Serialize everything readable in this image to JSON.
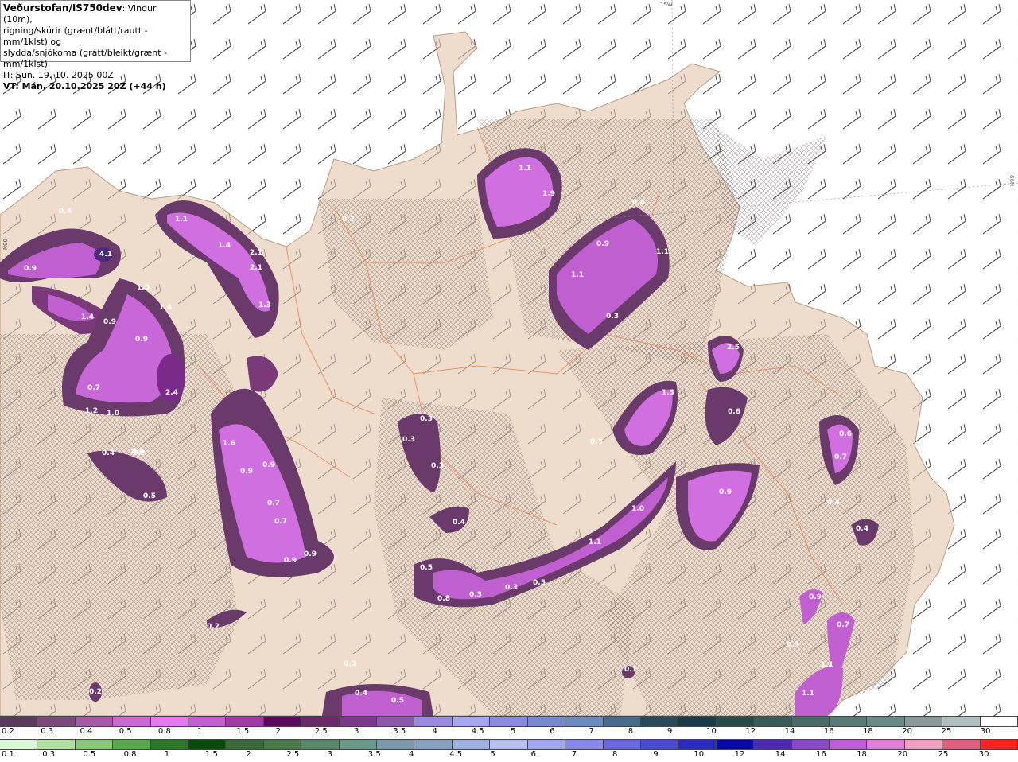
{
  "legend": {
    "title": "Veðurstofan/IS750dev",
    "line1": ": Vindur (10m),",
    "line2": "rigning/skúrir (grænt/blátt/rautt - mm/1klst) og",
    "line3": "slydda/snjókoma (grátt/bleikt/grænt - mm/1klst)",
    "it": "IT: Sun. 19. 10. 2025 00Z",
    "vt": "VT: Mán. 20.10.2025 20Z (+44 h)"
  },
  "grid_labels": {
    "top": "15W",
    "right": "66N",
    "left": "66N"
  },
  "precip_labels": [
    {
      "v": "0.4"
    },
    {
      "v": "4.1"
    },
    {
      "v": "0.9"
    },
    {
      "v": "1.1"
    },
    {
      "v": "1.4"
    },
    {
      "v": "2.1"
    },
    {
      "v": "2.1"
    },
    {
      "v": "1.3"
    },
    {
      "v": "1.0"
    },
    {
      "v": "1.4"
    },
    {
      "v": "1.4"
    },
    {
      "v": "0.9"
    },
    {
      "v": "0.9"
    },
    {
      "v": "2.4"
    },
    {
      "v": "0.7"
    },
    {
      "v": "1.2"
    },
    {
      "v": "1.0"
    },
    {
      "v": "0.9"
    },
    {
      "v": "1.6"
    },
    {
      "v": "0.9"
    },
    {
      "v": "0.9"
    },
    {
      "v": "0.7"
    },
    {
      "v": "0.7"
    },
    {
      "v": "0.9"
    },
    {
      "v": "0.9"
    },
    {
      "v": "0.4"
    },
    {
      "v": "0.8"
    },
    {
      "v": "0.5"
    },
    {
      "v": "1.1"
    },
    {
      "v": "1.9"
    },
    {
      "v": "0.4"
    },
    {
      "v": "0.9"
    },
    {
      "v": "1.1"
    },
    {
      "v": "1.1"
    },
    {
      "v": "0.3"
    },
    {
      "v": "0.2"
    },
    {
      "v": "2.5"
    },
    {
      "v": "1.3"
    },
    {
      "v": "0.6"
    },
    {
      "v": "0.3"
    },
    {
      "v": "0.3"
    },
    {
      "v": "0.3"
    },
    {
      "v": "0.3"
    },
    {
      "v": "0.4"
    },
    {
      "v": "1.0"
    },
    {
      "v": "0.9"
    },
    {
      "v": "1.1"
    },
    {
      "v": "0.5"
    },
    {
      "v": "0.5"
    },
    {
      "v": "0.8"
    },
    {
      "v": "0.3"
    },
    {
      "v": "0.3"
    },
    {
      "v": "0.6"
    },
    {
      "v": "0.7"
    },
    {
      "v": "0.4"
    },
    {
      "v": "0.4"
    },
    {
      "v": "0.9"
    },
    {
      "v": "0.7"
    },
    {
      "v": "0.3"
    },
    {
      "v": "1.1"
    },
    {
      "v": "1.1"
    },
    {
      "v": "0.2"
    },
    {
      "v": "0.3"
    },
    {
      "v": "0.4"
    },
    {
      "v": "0.5"
    },
    {
      "v": "0.2"
    },
    {
      "v": "0.1"
    }
  ],
  "snow_scale": {
    "colors": [
      "#5b3a5b",
      "#7b4a7b",
      "#a65aa6",
      "#c86ad0",
      "#e37af0",
      "#c060d0",
      "#a03ca8",
      "#5a0a5a",
      "#6a2a6a",
      "#7a3a8a",
      "#8a5aa8",
      "#9a8ae0",
      "#a8a8f0",
      "#8a8ae0",
      "#7a8ad0",
      "#6a8ac0",
      "#4a6a8a",
      "#2a4a5a",
      "#1a3a4a",
      "#2a4a4a",
      "#3a5a5a",
      "#4a6a6a",
      "#5a7a7a",
      "#6a8a8a",
      "#8a9a9a",
      "#b0c0c0",
      "#ffffff"
    ],
    "labels": [
      "0.2",
      "0.3",
      "0.4",
      "0.5",
      "0.8",
      "1",
      "1.5",
      "2",
      "2.5",
      "3",
      "3.5",
      "4",
      "4.5",
      "5",
      "6",
      "7",
      "8",
      "9",
      "10",
      "12",
      "14",
      "16",
      "18",
      "20",
      "25",
      "30"
    ]
  },
  "rain_scale": {
    "colors": [
      "#d8f8d8",
      "#b0e0a0",
      "#88c878",
      "#58a850",
      "#2a7a2a",
      "#0a4a0a",
      "#3a6a3a",
      "#4a7a4a",
      "#5a8a6a",
      "#6a9a8a",
      "#7a9aa8",
      "#8aa0c0",
      "#a0b0e0",
      "#b8c0f0",
      "#a0a8f0",
      "#8888e8",
      "#6a6ae0",
      "#4a4ad0",
      "#2a2ac0",
      "#0a0aa8",
      "#4a2ab0",
      "#8a4ac8",
      "#c060d8",
      "#e080d8",
      "#f0a0c0",
      "#e06080",
      "#ff2020"
    ],
    "labels": [
      "0.1",
      "0.3",
      "0.5",
      "0.8",
      "1",
      "1.5",
      "2",
      "2.5",
      "3",
      "3.5",
      "4",
      "4.5",
      "5",
      "6",
      "7",
      "8",
      "9",
      "10",
      "12",
      "14",
      "16",
      "18",
      "20",
      "25",
      "30"
    ]
  }
}
